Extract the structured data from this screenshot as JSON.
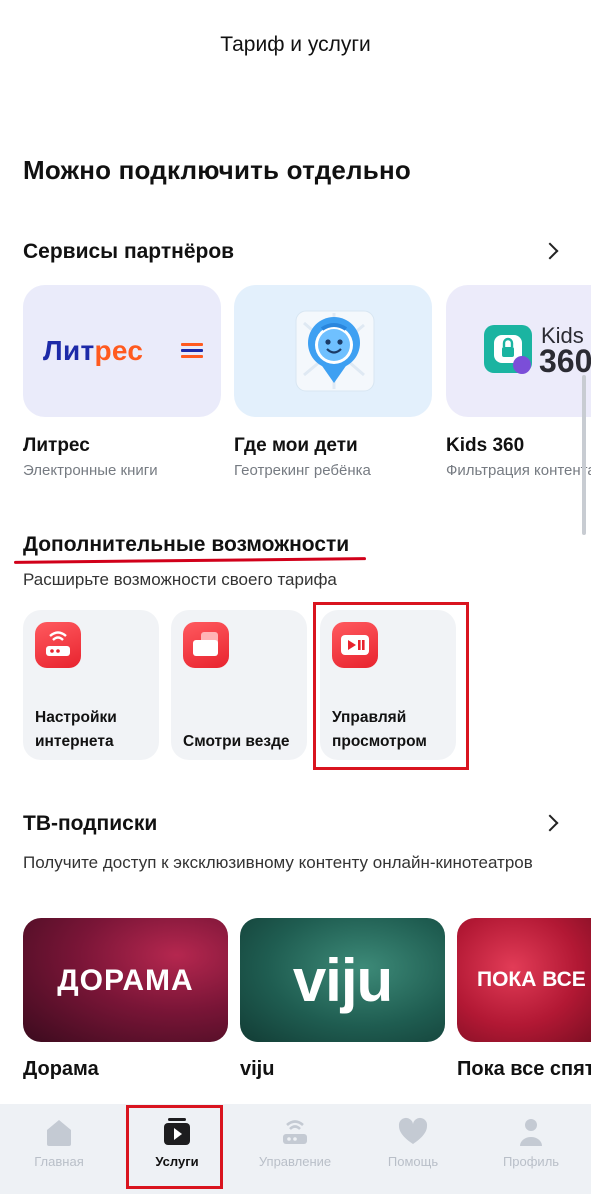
{
  "header": {
    "title": "Тариф и услуги"
  },
  "main_title": "Можно подключить отдельно",
  "partners": {
    "title": "Сервисы партнёров",
    "items": [
      {
        "name": "Литрес",
        "subtitle": "Электронные книги",
        "logo_a": "Лит",
        "logo_b": "рес"
      },
      {
        "name": "Где мои дети",
        "subtitle": "Геотрекинг ребёнка"
      },
      {
        "name": "Kids 360",
        "subtitle": "Фильтрация контента",
        "logo_top": "Kids",
        "logo_bottom": "360"
      }
    ]
  },
  "extras": {
    "title": "Дополнительные возможности",
    "subtitle": "Расширьте возможности своего тарифа",
    "items": [
      {
        "label": "Настройки интернета",
        "icon": "router-icon"
      },
      {
        "label": "Смотри везде",
        "icon": "multi-screen-icon"
      },
      {
        "label": "Управляй просмотром",
        "icon": "play-pause-icon"
      }
    ]
  },
  "tv": {
    "title": "ТВ-подписки",
    "subtitle": "Получите доступ к эксклюзивному контенту онлайн-кинотеатров",
    "items": [
      {
        "name": "Дорама",
        "logo": "ДОРАМА"
      },
      {
        "name": "viju",
        "logo": "viju"
      },
      {
        "name": "Пока все спят",
        "logo": "ПОКА ВСЕ СПЯТ"
      }
    ]
  },
  "bottom_nav": {
    "items": [
      {
        "label": "Главная",
        "icon": "home-icon"
      },
      {
        "label": "Услуги",
        "icon": "tv-play-icon",
        "active": true
      },
      {
        "label": "Управление",
        "icon": "router-icon"
      },
      {
        "label": "Помощь",
        "icon": "heart-icon"
      },
      {
        "label": "Профиль",
        "icon": "profile-icon"
      }
    ]
  },
  "colors": {
    "accent_red": "#e8232e",
    "highlight_red": "#d9141f",
    "nav_bg": "#eef1f5"
  }
}
